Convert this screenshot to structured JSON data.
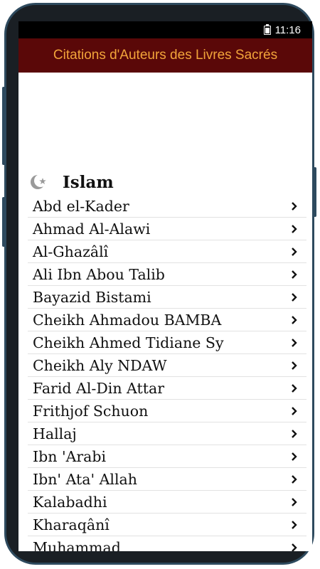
{
  "status": {
    "time": "11:16"
  },
  "app": {
    "title": "Citations d'Auteurs des Livres Sacrés"
  },
  "section": {
    "title": "Islam"
  },
  "authors": [
    "Abd el-Kader",
    "Ahmad Al-Alawi",
    "Al-Ghazâlî",
    "Ali Ibn Abou Talib",
    "Bayazid Bistami",
    "Cheikh Ahmadou BAMBA",
    "Cheikh Ahmed Tidiane Sy",
    "Cheikh Aly NDAW",
    "Farid Al-Din Attar",
    "Frithjof Schuon",
    "Hallaj",
    "Ibn 'Arabi",
    "Ibn' Ata' Allah",
    "Kalabadhi",
    "Kharaqânî",
    "Muhammad"
  ],
  "colors": {
    "appbar_bg": "#5a0808",
    "appbar_text": "#f2a43a",
    "frame": "#2e4a5e"
  }
}
